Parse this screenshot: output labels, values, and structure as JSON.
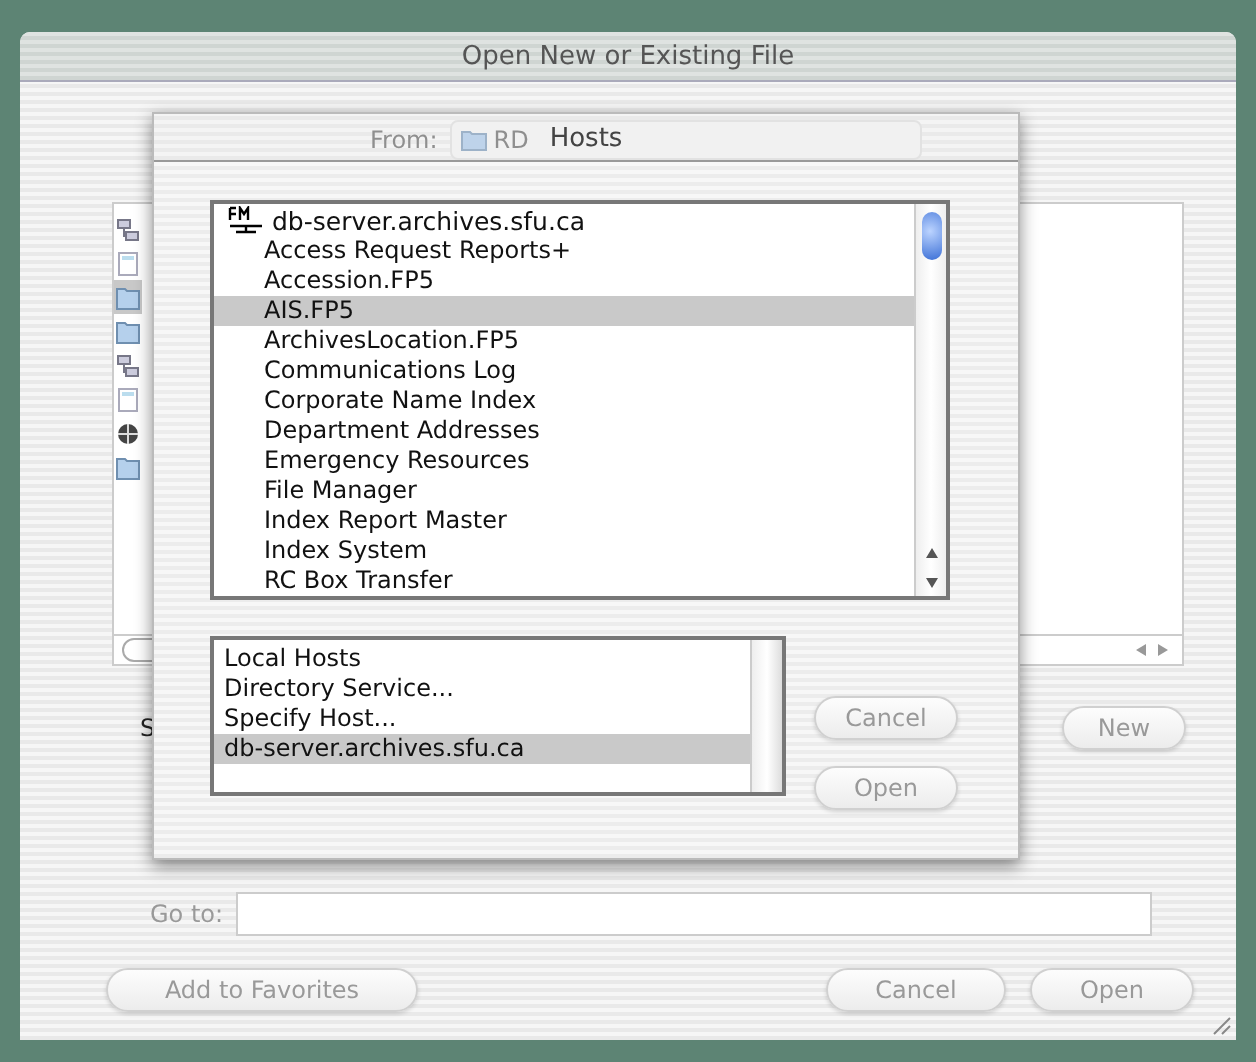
{
  "window": {
    "title": "Open New or Existing File"
  },
  "from": {
    "label": "From:",
    "value": "RD"
  },
  "show_label": "S",
  "new_button": "New",
  "goto": {
    "label": "Go to:"
  },
  "buttons": [
    "Add to Favorites",
    "Cancel",
    "Open"
  ],
  "sheet": {
    "title": "Hosts",
    "host": "db-server.archives.sfu.ca",
    "files": [
      {
        "label": "Access Request Reports+",
        "selected": false
      },
      {
        "label": "Accession.FP5",
        "selected": false
      },
      {
        "label": "AIS.FP5",
        "selected": true
      },
      {
        "label": "ArchivesLocation.FP5",
        "selected": false
      },
      {
        "label": "Communications Log",
        "selected": false
      },
      {
        "label": "Corporate Name Index",
        "selected": false
      },
      {
        "label": "Department Addresses",
        "selected": false
      },
      {
        "label": "Emergency Resources",
        "selected": false
      },
      {
        "label": "File Manager",
        "selected": false
      },
      {
        "label": "Index Report Master",
        "selected": false
      },
      {
        "label": "Index System",
        "selected": false
      },
      {
        "label": "RC Box Transfer",
        "selected": false
      }
    ],
    "hosts": [
      {
        "label": "Local Hosts",
        "selected": false
      },
      {
        "label": "Directory Service...",
        "selected": false
      },
      {
        "label": "Specify Host...",
        "selected": false
      },
      {
        "label": "db-server.archives.sfu.ca",
        "selected": true
      }
    ],
    "buttons": [
      "Cancel",
      "Open"
    ]
  }
}
